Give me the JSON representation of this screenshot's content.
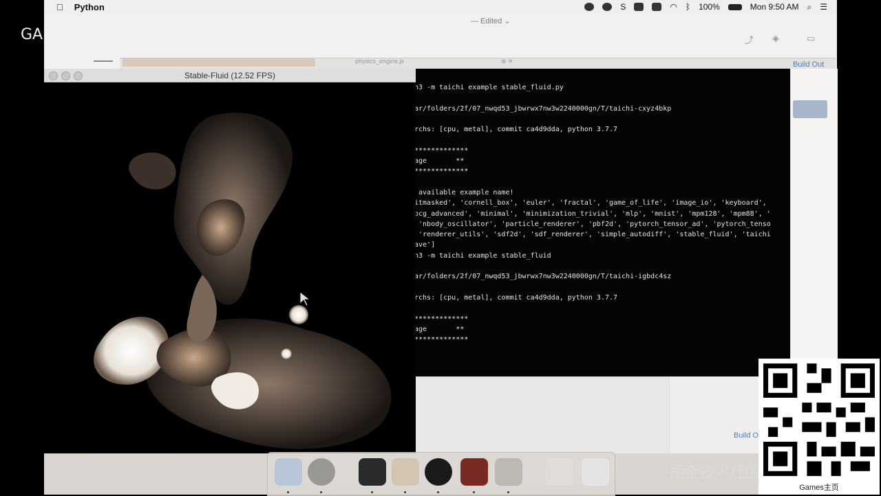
{
  "overlay_label": "GA",
  "menubar": {
    "app_name": "Python",
    "battery": "100%",
    "clock": "Mon 9:50 AM"
  },
  "editor": {
    "title": "— Edited ⌄",
    "tab_name": "physics_engine.js",
    "build_out_top": "Build Out",
    "build_out_bottom": "Build O"
  },
  "fluid_window": {
    "title": "Stable-Fluid (12.52 FPS)"
  },
  "terminal": {
    "lines": [
      "n3 -m taichi example stable_fluid.py",
      "",
      "ar/folders/2f/07_nwqd53_jbwrwx7nw3w2240000gn/T/taichi-cxyz4bkp",
      "",
      "rchs: [cpu, metal], commit ca4d9dda, python 3.7.7",
      "",
      "*************",
      "age       **",
      "*************",
      "",
      " available example name!",
      "itmasked', 'cornell_box', 'euler', 'fractal', 'game_of_life', 'image_io', 'keyboard',",
      "pcg_advanced', 'minimal', 'minimization_trivial', 'mlp', 'mnist', 'mpm128', 'mpm88', '",
      " 'nbody_oscillator', 'particle_renderer', 'pbf2d', 'pytorch_tensor_ad', 'pytorch_tenso",
      " 'renderer_utils', 'sdf2d', 'sdf_renderer', 'simple_autodiff', 'stable_fluid', 'taichi",
      "ave']",
      "n3 -m taichi example stable_fluid",
      "",
      "ar/folders/2f/07_nwqd53_jbwrwx7nw3w2240000gn/T/taichi-igbdc4sz",
      "",
      "rchs: [cpu, metal], commit ca4d9dda, python 3.7.7",
      "",
      "*************",
      "age       **",
      "*************"
    ]
  },
  "watermark": "掘金技术社区 @ 布客飞龙",
  "qr_caption": "Games主页",
  "dock_icons": [
    "finder-icon",
    "safari-icon",
    "terminal-icon",
    "keynote-icon",
    "obs-icon",
    "acrobat-icon",
    "rocket-icon",
    "folder-icon",
    "trash-icon"
  ]
}
